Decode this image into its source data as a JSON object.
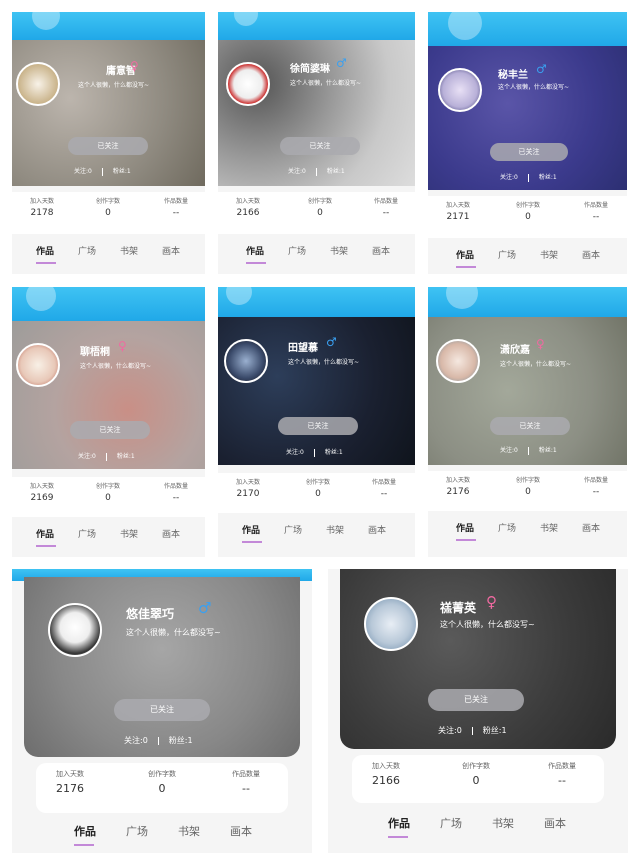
{
  "bio": "这个人很懒，什么都没写~",
  "follow_button": "已关注",
  "labels": {
    "followers": "关注:0",
    "fans": "粉丝:1",
    "days": "加入天数",
    "works": "创作字数",
    "books": "作品数量"
  },
  "tabs": [
    "作品",
    "广场",
    "书架",
    "画本"
  ],
  "profiles": [
    {
      "name": "庸意智",
      "gender": "♀",
      "days": "2178",
      "works": "0",
      "books": "--"
    },
    {
      "name": "徐简婆琳",
      "gender": "♂",
      "days": "2166",
      "works": "0",
      "books": "--"
    },
    {
      "name": "秘丰兰",
      "gender": "♂",
      "days": "2171",
      "works": "0",
      "books": "--"
    },
    {
      "name": "聊梧桐",
      "gender": "♀",
      "days": "2169",
      "works": "0",
      "books": "--"
    },
    {
      "name": "田望慕",
      "gender": "♂",
      "days": "2170",
      "works": "0",
      "books": "--"
    },
    {
      "name": "潇欣嘉",
      "gender": "♀",
      "days": "2176",
      "works": "0",
      "books": "--"
    },
    {
      "name": "悠佳翠巧",
      "gender": "♂",
      "days": "2176",
      "works": "0",
      "books": "--"
    },
    {
      "name": "禚菁英",
      "gender": "♀",
      "days": "2166",
      "works": "0",
      "books": "--"
    }
  ],
  "colors": {
    "header_blue": "#20a8e8",
    "female": "#f06aa1",
    "male": "#3aa0f0",
    "tab_underline": "#c389d8"
  }
}
